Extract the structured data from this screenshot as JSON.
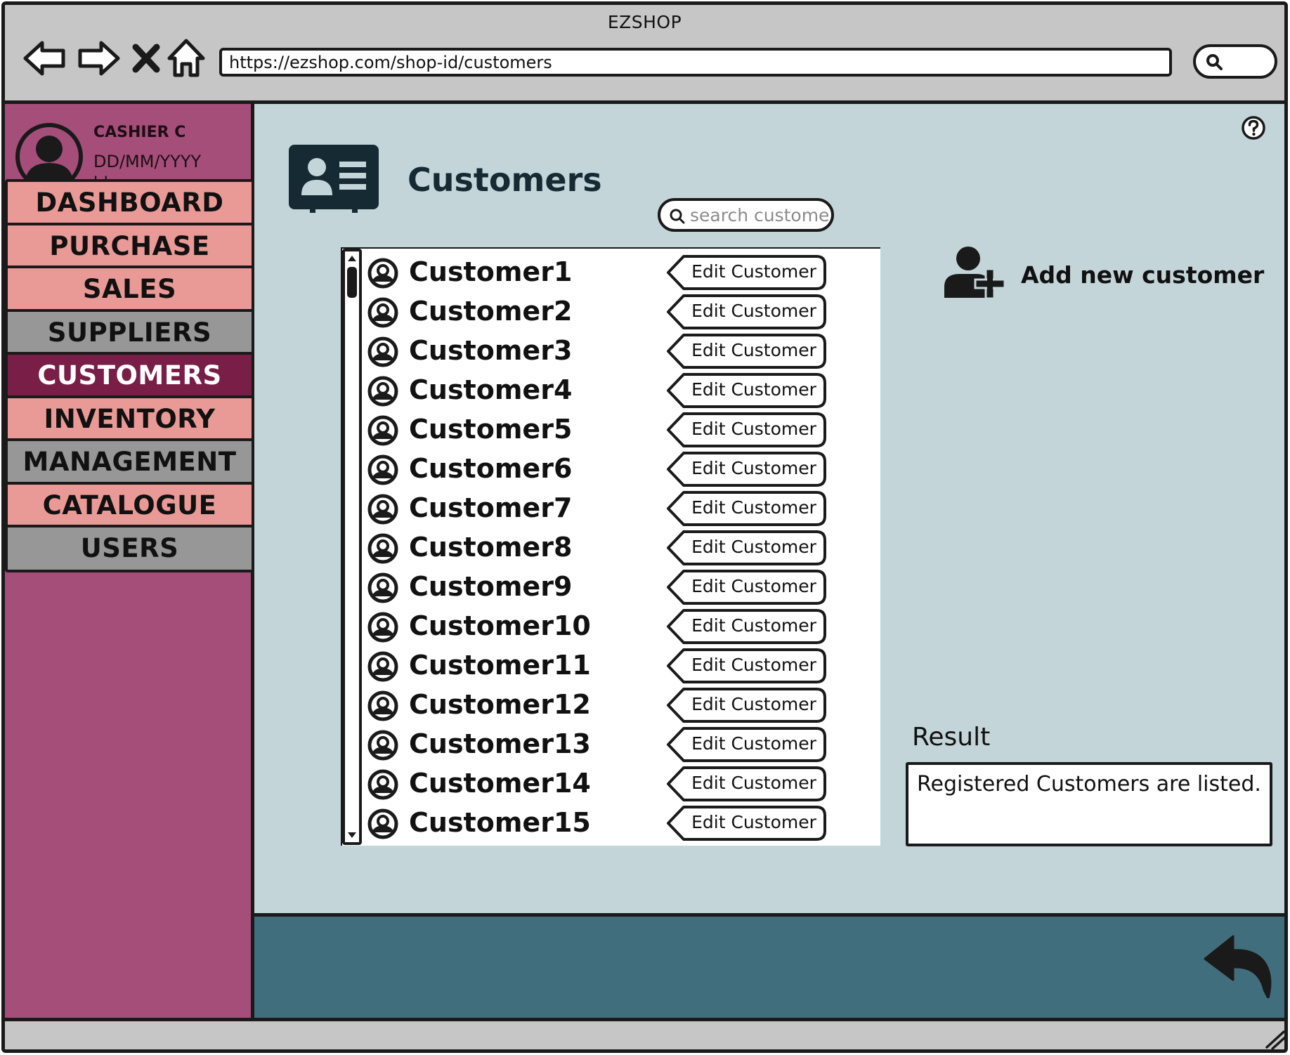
{
  "app": {
    "title": "EZSHOP",
    "url": "https://ezshop.com/shop-id/customers"
  },
  "user": {
    "name": "CASHIER C",
    "date": "DD/MM/YYYY",
    "time": "hh:mm"
  },
  "sidebar": {
    "items": [
      {
        "label": "DASHBOARD",
        "style": "pink"
      },
      {
        "label": "PURCHASE",
        "style": "pink"
      },
      {
        "label": "SALES",
        "style": "pink"
      },
      {
        "label": "SUPPLIERS",
        "style": "grey"
      },
      {
        "label": "CUSTOMERS",
        "style": "active"
      },
      {
        "label": "INVENTORY",
        "style": "pink"
      },
      {
        "label": "MANAGEMENT",
        "style": "grey"
      },
      {
        "label": "CATALOGUE",
        "style": "pink"
      },
      {
        "label": "USERS",
        "style": "grey"
      }
    ]
  },
  "main": {
    "page_title": "Customers",
    "search_placeholder": "search customer",
    "add_customer_label": "Add new customer",
    "edit_button_label": "Edit Customer",
    "customers": [
      "Customer1",
      "Customer2",
      "Customer3",
      "Customer4",
      "Customer5",
      "Customer6",
      "Customer7",
      "Customer8",
      "Customer9",
      "Customer10",
      "Customer11",
      "Customer12",
      "Customer13",
      "Customer14",
      "Customer15"
    ],
    "result_label": "Result",
    "result_text": "Registered Customers are listed."
  },
  "colors": {
    "sidebar_bg": "#a64e7a",
    "nav_pink": "#ea9a96",
    "nav_grey": "#979797",
    "nav_active": "#781e47",
    "main_bg": "#c3d5d9",
    "footer_bg": "#416e7c",
    "chrome_bg": "#c6c6c6"
  },
  "icons": {
    "back": "back-arrow-icon",
    "forward": "forward-arrow-icon",
    "stop": "close-icon",
    "home": "home-icon",
    "search": "search-icon",
    "help": "help-icon",
    "page": "contact-card-icon",
    "add": "add-user-icon",
    "undo": "undo-icon",
    "resize": "resize-grip-icon"
  }
}
